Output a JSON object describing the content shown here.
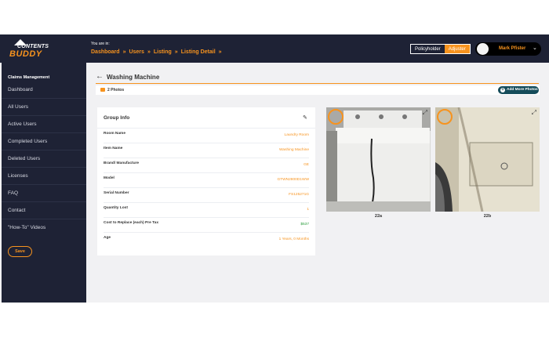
{
  "logo": {
    "line1": "CONTENTS",
    "line2": "BUDDY"
  },
  "header": {
    "you_are_in": "You are in:",
    "breadcrumbs": [
      "Dashboard",
      "Users",
      "Listing",
      "Listing Detail"
    ],
    "roles": [
      "Policyholder",
      "Adjuster"
    ],
    "active_role": "Adjuster",
    "user_name": "Mark Pfister"
  },
  "sidebar": {
    "section": "Claims Management",
    "items": [
      "Dashboard",
      "All Users",
      "Active Users",
      "Completed Users",
      "Deleted Users",
      "Licenses",
      "FAQ",
      "Contact",
      "\"How-To\" Videos"
    ],
    "save_label": "Save"
  },
  "main": {
    "title": "Washing Machine",
    "photo_count": "2 Photos",
    "add_photos_label": "Add More Photos",
    "group_info": {
      "title": "Group Info",
      "rows": [
        {
          "label": "Room Name",
          "value": "Laundry Room"
        },
        {
          "label": "Item Name",
          "value": "Washing Machine"
        },
        {
          "label": "Brand/ Manufacture",
          "value": "GE"
        },
        {
          "label": "Model",
          "value": "GTWN2800D1WW"
        },
        {
          "label": "Serial Number",
          "value": "FS125271G"
        },
        {
          "label": "Quantity Lost",
          "value": "1"
        },
        {
          "label": "Cost to Replace (each) Pre Tax",
          "value": "$537"
        },
        {
          "label": "Age",
          "value": "1 Years, 0 Months"
        }
      ]
    },
    "photos": [
      {
        "caption": "22a"
      },
      {
        "caption": "22b"
      }
    ]
  },
  "colors": {
    "accent": "#f7931e",
    "navy": "#1e2235",
    "teal": "#154c5a",
    "green": "#2a9d3c"
  }
}
